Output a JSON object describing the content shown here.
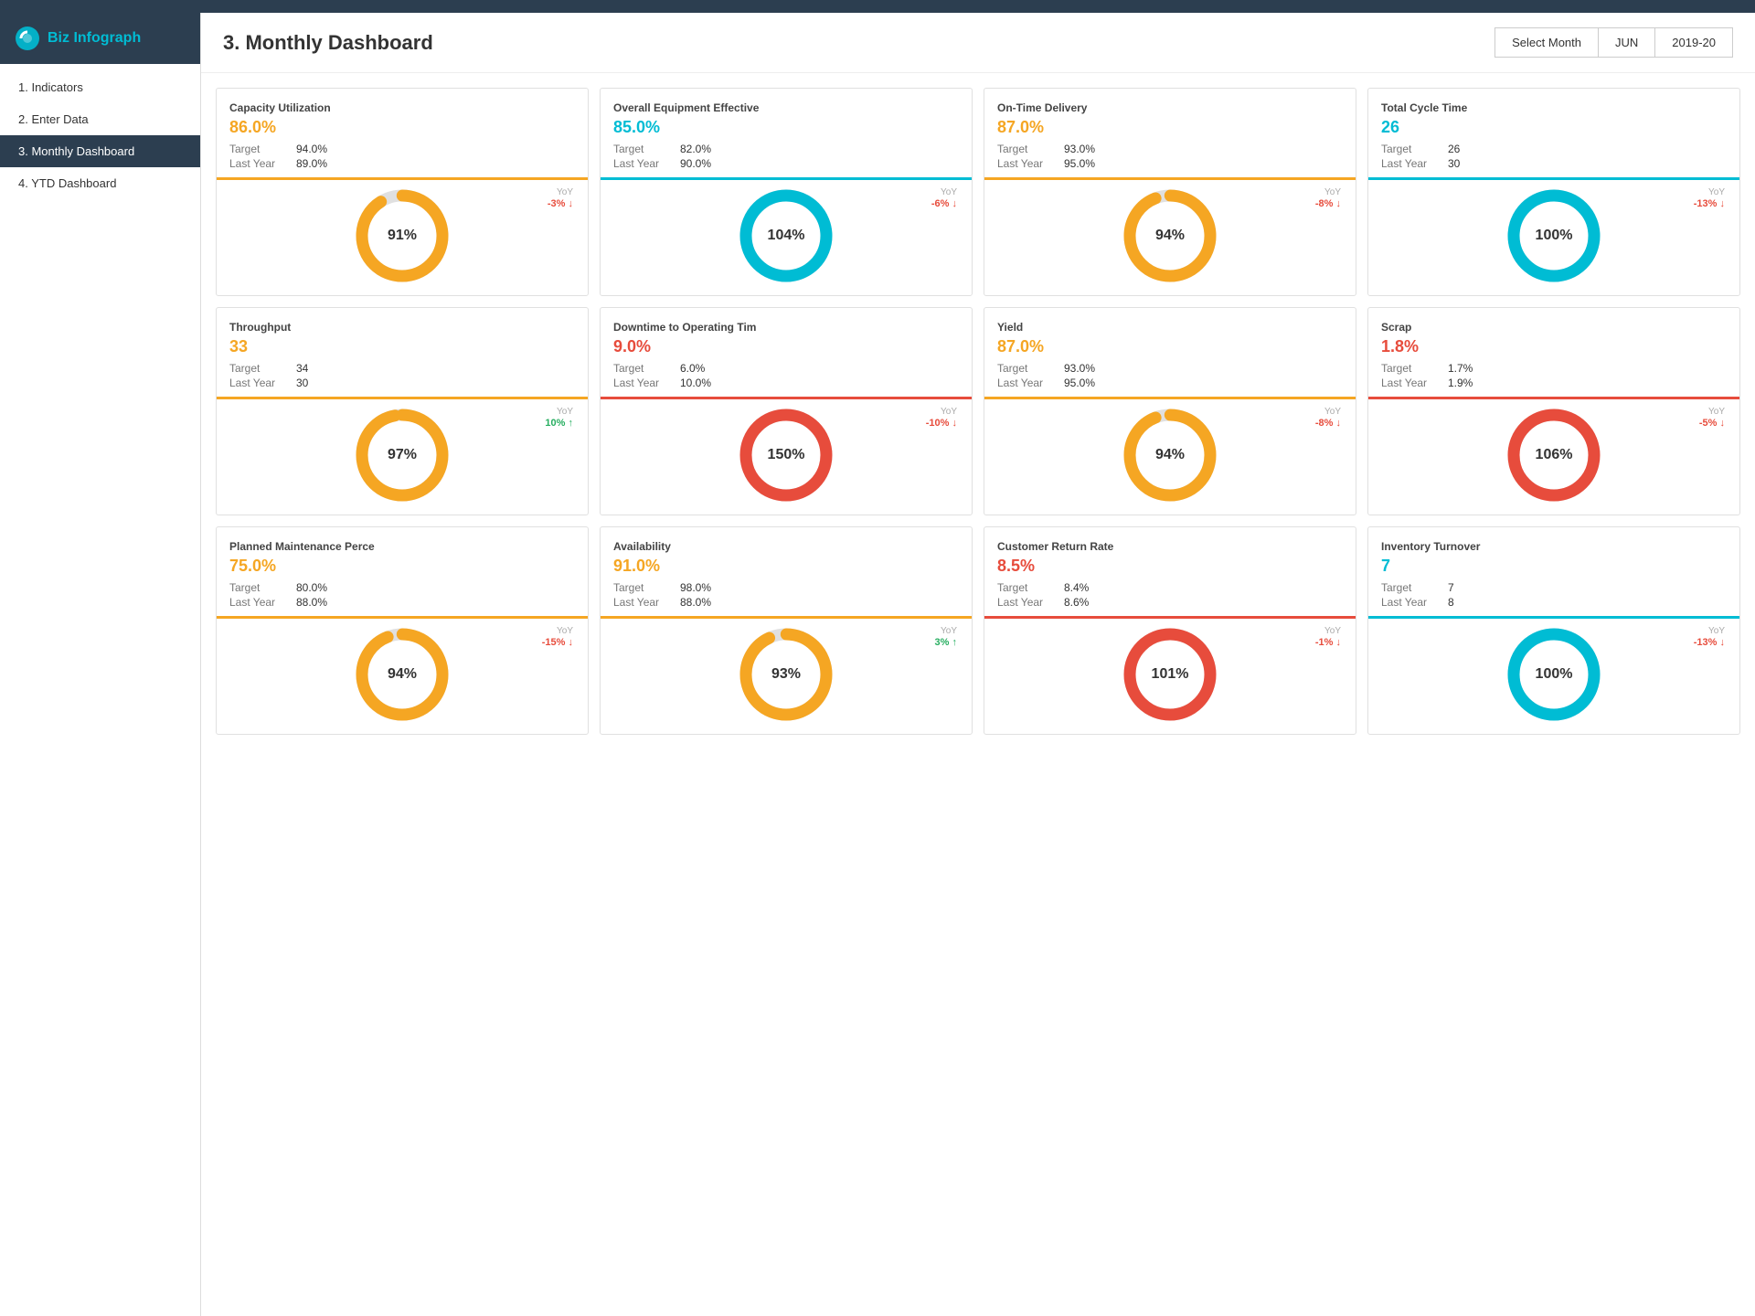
{
  "app": {
    "name_part1": "Biz",
    "name_part2": "Infograph"
  },
  "sidebar": {
    "items": [
      {
        "id": "indicators",
        "label": "1. Indicators",
        "active": false
      },
      {
        "id": "enter-data",
        "label": "2. Enter Data",
        "active": false
      },
      {
        "id": "monthly-dashboard",
        "label": "3. Monthly Dashboard",
        "active": true
      },
      {
        "id": "ytd-dashboard",
        "label": "4. YTD Dashboard",
        "active": false
      }
    ]
  },
  "header": {
    "title": "3. Monthly Dashboard",
    "select_month_label": "Select Month",
    "month": "JUN",
    "year": "2019-20"
  },
  "kpis": [
    {
      "id": "capacity-utilization",
      "title": "Capacity Utilization",
      "value": "86.0%",
      "value_color": "orange",
      "target": "94.0%",
      "last_year": "89.0%",
      "chart_pct": 91,
      "chart_display": "91%",
      "chart_color": "#f5a623",
      "chart_bg": "#e0e0e0",
      "divider_color": "orange",
      "yoy": "-3% ↓",
      "yoy_dir": "down"
    },
    {
      "id": "oee",
      "title": "Overall Equipment Effective",
      "value": "85.0%",
      "value_color": "teal",
      "target": "82.0%",
      "last_year": "90.0%",
      "chart_pct": 104,
      "chart_display": "104%",
      "chart_color": "#00bcd4",
      "chart_bg": "#e0e0e0",
      "divider_color": "teal",
      "yoy": "-6% ↓",
      "yoy_dir": "down"
    },
    {
      "id": "on-time-delivery",
      "title": "On-Time Delivery",
      "value": "87.0%",
      "value_color": "orange",
      "target": "93.0%",
      "last_year": "95.0%",
      "chart_pct": 94,
      "chart_display": "94%",
      "chart_color": "#f5a623",
      "chart_bg": "#e0e0e0",
      "divider_color": "orange",
      "yoy": "-8% ↓",
      "yoy_dir": "down"
    },
    {
      "id": "total-cycle-time",
      "title": "Total Cycle Time",
      "value": "26",
      "value_color": "teal",
      "target": "26",
      "last_year": "30",
      "chart_pct": 100,
      "chart_display": "100%",
      "chart_color": "#00bcd4",
      "chart_bg": "#e0e0e0",
      "divider_color": "teal",
      "yoy": "-13% ↓",
      "yoy_dir": "down"
    },
    {
      "id": "throughput",
      "title": "Throughput",
      "value": "33",
      "value_color": "orange",
      "target": "34",
      "last_year": "30",
      "chart_pct": 97,
      "chart_display": "97%",
      "chart_color": "#f5a623",
      "chart_bg": "#e0e0e0",
      "divider_color": "orange",
      "yoy": "10% ↑",
      "yoy_dir": "up"
    },
    {
      "id": "downtime",
      "title": "Downtime to Operating Tim",
      "value": "9.0%",
      "value_color": "red",
      "target": "6.0%",
      "last_year": "10.0%",
      "chart_pct": 150,
      "chart_display": "150%",
      "chart_color": "#e74c3c",
      "chart_bg": "#e0e0e0",
      "divider_color": "red",
      "yoy": "-10% ↓",
      "yoy_dir": "down"
    },
    {
      "id": "yield",
      "title": "Yield",
      "value": "87.0%",
      "value_color": "orange",
      "target": "93.0%",
      "last_year": "95.0%",
      "chart_pct": 94,
      "chart_display": "94%",
      "chart_color": "#f5a623",
      "chart_bg": "#e0e0e0",
      "divider_color": "orange",
      "yoy": "-8% ↓",
      "yoy_dir": "down"
    },
    {
      "id": "scrap",
      "title": "Scrap",
      "value": "1.8%",
      "value_color": "red",
      "target": "1.7%",
      "last_year": "1.9%",
      "chart_pct": 106,
      "chart_display": "106%",
      "chart_color": "#e74c3c",
      "chart_bg": "#e0e0e0",
      "divider_color": "red",
      "yoy": "-5% ↓",
      "yoy_dir": "down"
    },
    {
      "id": "planned-maintenance",
      "title": "Planned Maintenance Perce",
      "value": "75.0%",
      "value_color": "orange",
      "target": "80.0%",
      "last_year": "88.0%",
      "chart_pct": 94,
      "chart_display": "94%",
      "chart_color": "#f5a623",
      "chart_bg": "#e0e0e0",
      "divider_color": "orange",
      "yoy": "-15% ↓",
      "yoy_dir": "down"
    },
    {
      "id": "availability",
      "title": "Availability",
      "value": "91.0%",
      "value_color": "orange",
      "target": "98.0%",
      "last_year": "88.0%",
      "chart_pct": 93,
      "chart_display": "93%",
      "chart_color": "#f5a623",
      "chart_bg": "#e0e0e0",
      "divider_color": "orange",
      "yoy": "3% ↑",
      "yoy_dir": "up"
    },
    {
      "id": "customer-return-rate",
      "title": "Customer Return Rate",
      "value": "8.5%",
      "value_color": "red",
      "target": "8.4%",
      "last_year": "8.6%",
      "chart_pct": 101,
      "chart_display": "101%",
      "chart_color": "#e74c3c",
      "chart_bg": "#e0e0e0",
      "divider_color": "red",
      "yoy": "-1% ↓",
      "yoy_dir": "down"
    },
    {
      "id": "inventory-turnover",
      "title": "Inventory Turnover",
      "value": "7",
      "value_color": "teal",
      "target": "7",
      "last_year": "8",
      "chart_pct": 100,
      "chart_display": "100%",
      "chart_color": "#00bcd4",
      "chart_bg": "#e0e0e0",
      "divider_color": "teal",
      "yoy": "-13% ↓",
      "yoy_dir": "down"
    }
  ],
  "labels": {
    "target": "Target",
    "last_year": "Last Year",
    "yoy": "YoY"
  }
}
